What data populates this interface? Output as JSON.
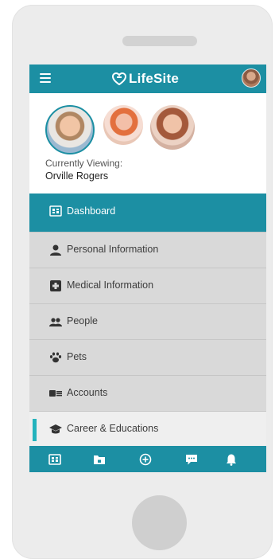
{
  "app": {
    "brand": "LifeSite"
  },
  "profile": {
    "viewing_label": "Currently Viewing:",
    "viewing_name": "Orville Rogers"
  },
  "menu": {
    "items": [
      {
        "label": "Dashboard",
        "icon": "dashboard-icon",
        "state": "active"
      },
      {
        "label": "Personal Information",
        "icon": "person-icon"
      },
      {
        "label": "Medical Information",
        "icon": "medical-cross-icon"
      },
      {
        "label": "People",
        "icon": "people-icon"
      },
      {
        "label": "Pets",
        "icon": "paw-icon"
      },
      {
        "label": "Accounts",
        "icon": "accounts-icon"
      },
      {
        "label": "Career & Educations",
        "icon": "graduation-cap-icon",
        "state": "highlighted"
      }
    ]
  },
  "bottom_nav": {
    "icons": [
      "dashboard-icon",
      "folder-lock-icon",
      "add-circle-icon",
      "chat-icon",
      "bell-icon"
    ]
  },
  "colors": {
    "primary": "#1c8fa3",
    "accent": "#24b3bd",
    "menu_bg": "#d9d9d9"
  }
}
